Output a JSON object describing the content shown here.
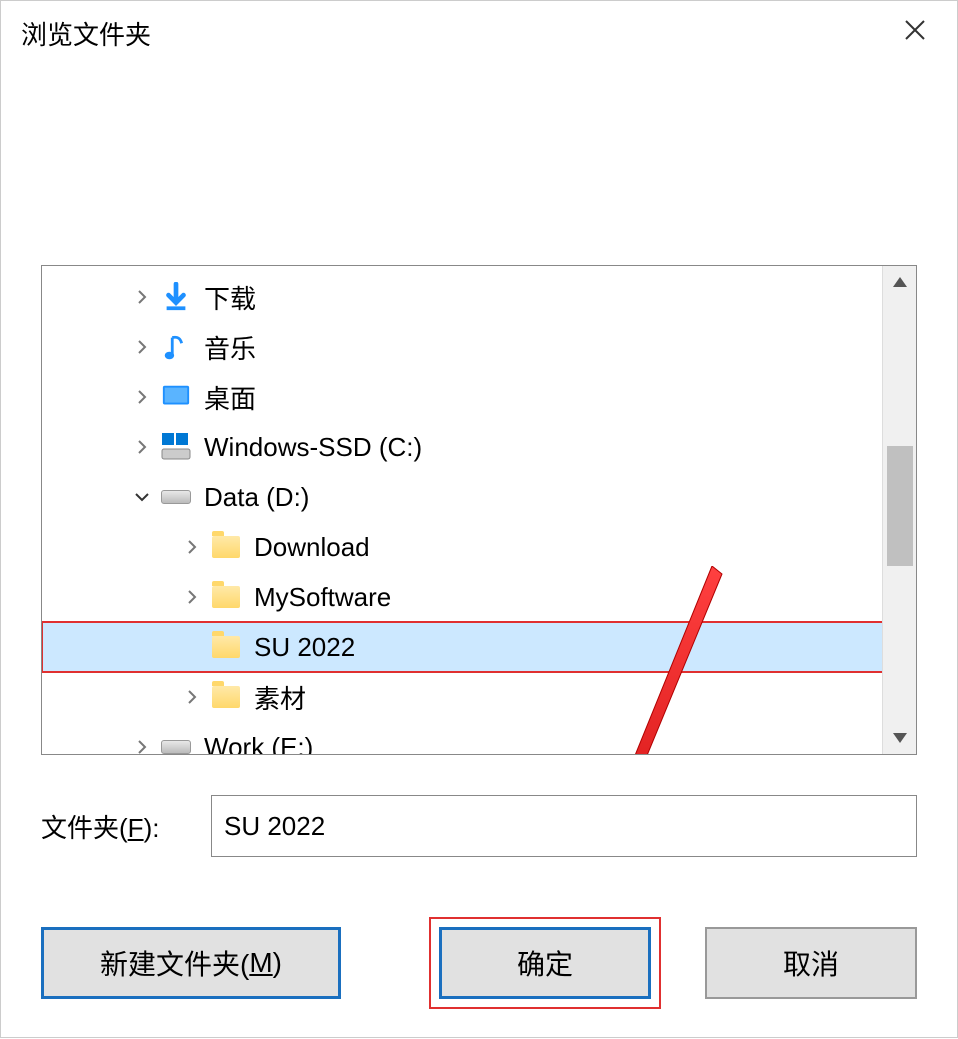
{
  "dialog": {
    "title": "浏览文件夹"
  },
  "tree": {
    "items": [
      {
        "label": "下载",
        "icon": "download",
        "indent": 1,
        "expander": "collapsed"
      },
      {
        "label": "音乐",
        "icon": "music",
        "indent": 1,
        "expander": "collapsed"
      },
      {
        "label": "桌面",
        "icon": "desktop",
        "indent": 1,
        "expander": "collapsed"
      },
      {
        "label": "Windows-SSD (C:)",
        "icon": "drive-win",
        "indent": 1,
        "expander": "collapsed"
      },
      {
        "label": "Data (D:)",
        "icon": "drive",
        "indent": 1,
        "expander": "expanded"
      },
      {
        "label": "Download",
        "icon": "folder",
        "indent": 2,
        "expander": "collapsed"
      },
      {
        "label": "MySoftware",
        "icon": "folder",
        "indent": 2,
        "expander": "collapsed"
      },
      {
        "label": "SU 2022",
        "icon": "folder",
        "indent": 2,
        "expander": "none",
        "selected": true,
        "highlighted": true
      },
      {
        "label": "素材",
        "icon": "folder",
        "indent": 2,
        "expander": "collapsed"
      },
      {
        "label": "Work (E:)",
        "icon": "drive",
        "indent": 1,
        "expander": "collapsed"
      }
    ]
  },
  "folder_field": {
    "label_prefix": "文件夹(",
    "label_hotkey": "F",
    "label_suffix": "):",
    "value": "SU 2022"
  },
  "buttons": {
    "new_folder_prefix": "新建文件夹(",
    "new_folder_hotkey": "M",
    "new_folder_suffix": ")",
    "ok": "确定",
    "cancel": "取消"
  }
}
